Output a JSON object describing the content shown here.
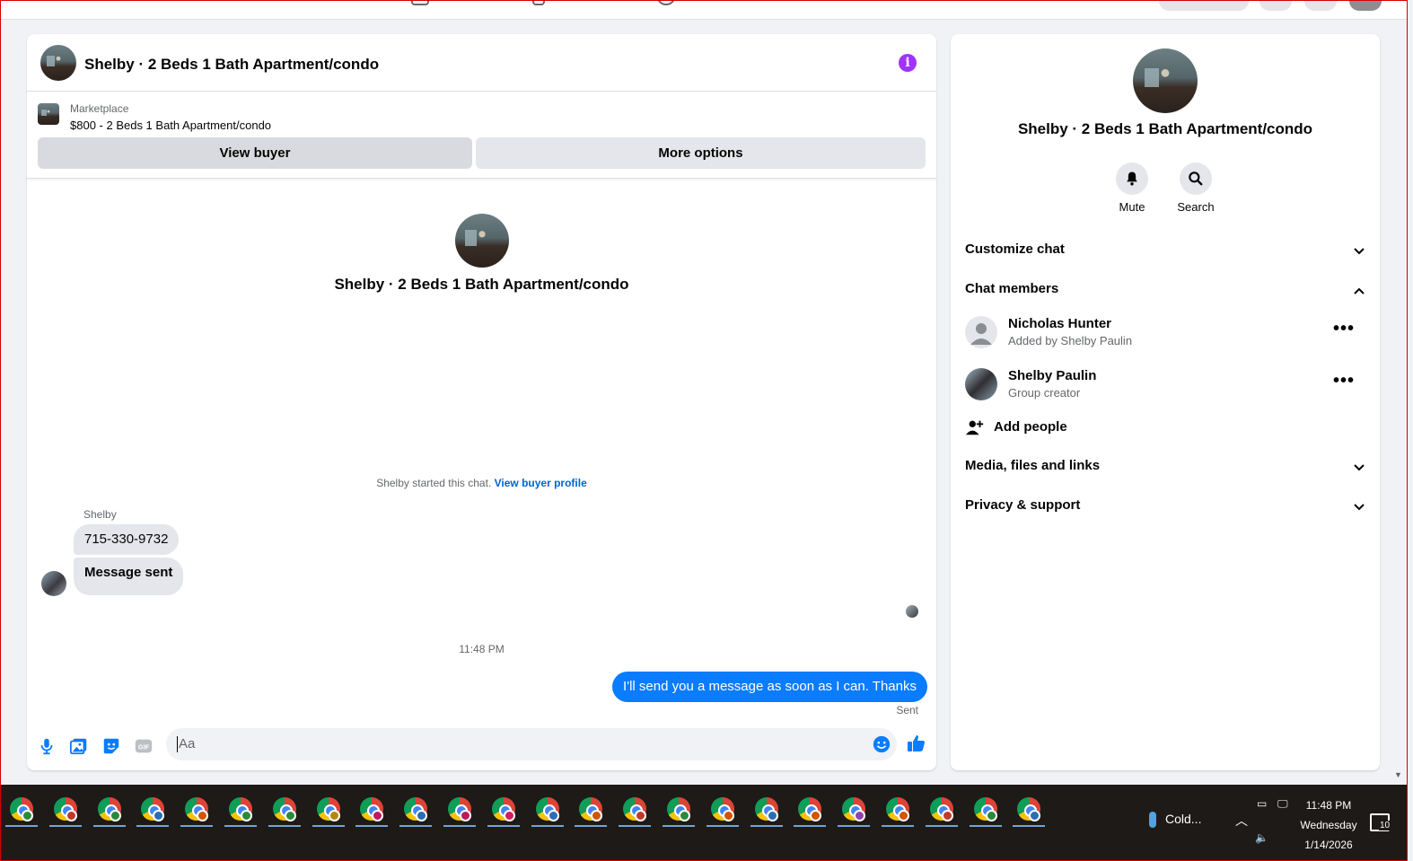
{
  "chat": {
    "title": "Shelby · 2 Beds 1 Bath Apartment/condo",
    "listing": {
      "source": "Marketplace",
      "title": "$800 - 2 Beds 1 Bath Apartment/condo",
      "view_buyer_label": "View buyer",
      "more_options_label": "More options"
    },
    "intro_title": "Shelby · 2 Beds 1 Bath Apartment/condo",
    "started_text": "Shelby started this chat.",
    "started_link": "View buyer profile",
    "sender_name": "Shelby",
    "incoming": [
      "715-330-9732",
      "Message sent"
    ],
    "timestamp": "11:48 PM",
    "outgoing": "I'll send you a message as soon as I can. Thanks",
    "sent_label": "Sent",
    "composer_placeholder": "Aa"
  },
  "side": {
    "title": "Shelby · 2 Beds 1 Bath Apartment/condo",
    "mute_label": "Mute",
    "search_label": "Search",
    "sections": {
      "customize": "Customize chat",
      "members": "Chat members",
      "media": "Media, files and links",
      "privacy": "Privacy & support"
    },
    "members": [
      {
        "name": "Nicholas Hunter",
        "sub": "Added by Shelby Paulin"
      },
      {
        "name": "Shelby Paulin",
        "sub": "Group creator"
      }
    ],
    "add_people": "Add people"
  },
  "taskbar": {
    "weather": "Cold...",
    "time": "11:48 PM",
    "day": "Wednesday",
    "date": "1/14/2026",
    "notifications": "10",
    "badge_colors": [
      "#2a8a3a",
      "#c0392b",
      "#2a8a3a",
      "#2a6db5",
      "#d35400",
      "#2a8a3a",
      "#2a8a3a",
      "#b8860b",
      "#c2185b",
      "#2a6db5",
      "#c2185b",
      "#d81b60",
      "#2a6db5",
      "#d35400",
      "#c0392b",
      "#2a8a3a",
      "#d35400",
      "#2a6db5",
      "#d35400",
      "#8e44ad",
      "#d35400",
      "#c0392b",
      "#2a8a3a",
      "#2a6db5"
    ]
  },
  "colors": {
    "accent": "#0a7cff",
    "info": "#a033ff",
    "link": "#0064d1"
  }
}
